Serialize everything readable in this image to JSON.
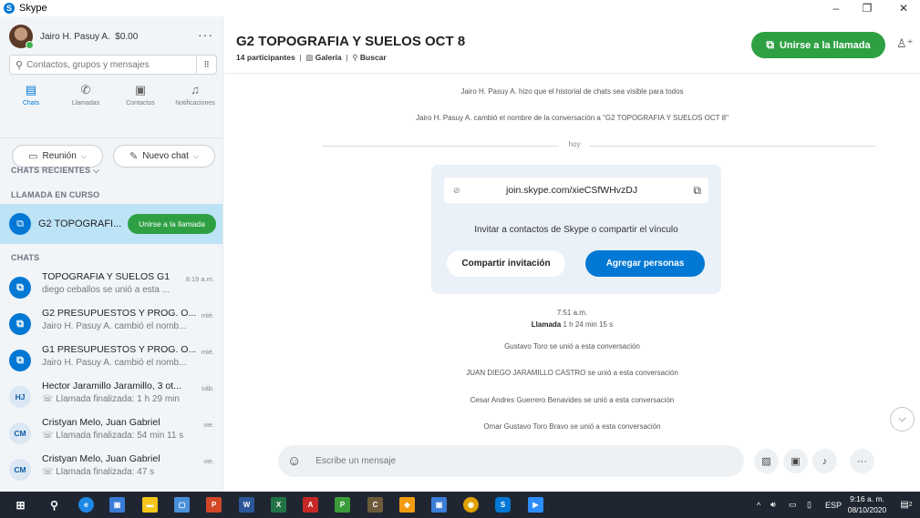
{
  "window": {
    "title": "Skype",
    "minimize": "–",
    "maximize": "❐",
    "close": "✕"
  },
  "profile": {
    "name": "Jairo H. Pasuy A.",
    "credit": "$0.00",
    "more": "···"
  },
  "search": {
    "placeholder": "Contactos, grupos y mensajes"
  },
  "nav": [
    {
      "label": "Chats",
      "icon": "chat-icon"
    },
    {
      "label": "Llamadas",
      "icon": "phone-icon"
    },
    {
      "label": "Contactos",
      "icon": "contacts-icon"
    },
    {
      "label": "Notificaciones",
      "icon": "bell-icon"
    }
  ],
  "actions": {
    "meeting": "Reunión",
    "new_chat": "Nuevo chat"
  },
  "sections": {
    "recent": "CHATS RECIENTES",
    "ongoing": "LLAMADA EN CURSO",
    "chats": "CHATS"
  },
  "ongoing_call": {
    "name": "G2 TOPOGRAFI...",
    "join": "Unirse a la llamada"
  },
  "chats": [
    {
      "title": "TOPOGRAFIA Y SUELOS G1",
      "time": "8:19 a.m.",
      "preview": "diego ceballos se unió a esta ...",
      "avatar": "group",
      "initials": ""
    },
    {
      "title": "G2 PRESUPUESTOS Y PROG. O...",
      "time": "mié.",
      "preview": "Jairo H. Pasuy A. cambió el nomb...",
      "avatar": "group",
      "initials": ""
    },
    {
      "title": "G1 PRESUPUESTOS Y PROG. O...",
      "time": "mié.",
      "preview": "Jairo H. Pasuy A. cambió el nomb...",
      "avatar": "group",
      "initials": ""
    },
    {
      "title": "Hector Jaramillo Jaramillo,  3 ot...",
      "time": "sáb.",
      "preview": "Llamada finalizada: 1 h 29 min",
      "avatar": "initials",
      "initials": "HJ"
    },
    {
      "title": "Cristyan Melo, Juan Gabriel",
      "time": "vie.",
      "preview": "Llamada finalizada: 54 min 11 s",
      "avatar": "initials",
      "initials": "CM"
    },
    {
      "title": "Cristyan Melo, Juan Gabriel",
      "time": "vie.",
      "preview": "Llamada finalizada: 47 s",
      "avatar": "initials",
      "initials": "CM"
    }
  ],
  "conversation": {
    "title": "G2 TOPOGRAFIA Y SUELOS OCT 8",
    "participants": "14 participantes",
    "gallery": "Galería",
    "search": "Buscar",
    "join_call": "Unirse a la llamada"
  },
  "messages": {
    "sys1": "Jairo H. Pasuy A. hizo que el historial de chats sea visible para todos",
    "sys2": "Jairo H. Pasuy A. cambió el nombre de la conversación a \"G2 TOPOGRAFIA Y SUELOS OCT 8\"",
    "today": "hoy",
    "call_time": "7:51 a.m.",
    "call_label": "Llamada",
    "call_duration": "1 h 24 min 15 s",
    "joined": [
      "Gustavo Toro se unió a esta conversación",
      "JUAN DIEGO JARAMILLO CASTRO se unió a esta conversación",
      "Cesar Andres Guerrero Benavides se unió a esta conversación",
      "Omar Gustavo Toro Bravo se unió a esta conversación"
    ]
  },
  "invite_card": {
    "link": "join.skype.com/xieCSfWHvzDJ",
    "text": "Invitar a contactos de Skype o compartir el vínculo",
    "share": "Compartir invitación",
    "add": "Agregar personas"
  },
  "composer": {
    "placeholder": "Escribe un mensaje"
  },
  "taskbar": {
    "language": "ESP",
    "time": "9:16 a. m.",
    "date": "08/10/2020",
    "notifications": "2"
  },
  "colors": {
    "accent": "#0078d4",
    "green": "#2ea043",
    "selected": "#bde3f7"
  }
}
